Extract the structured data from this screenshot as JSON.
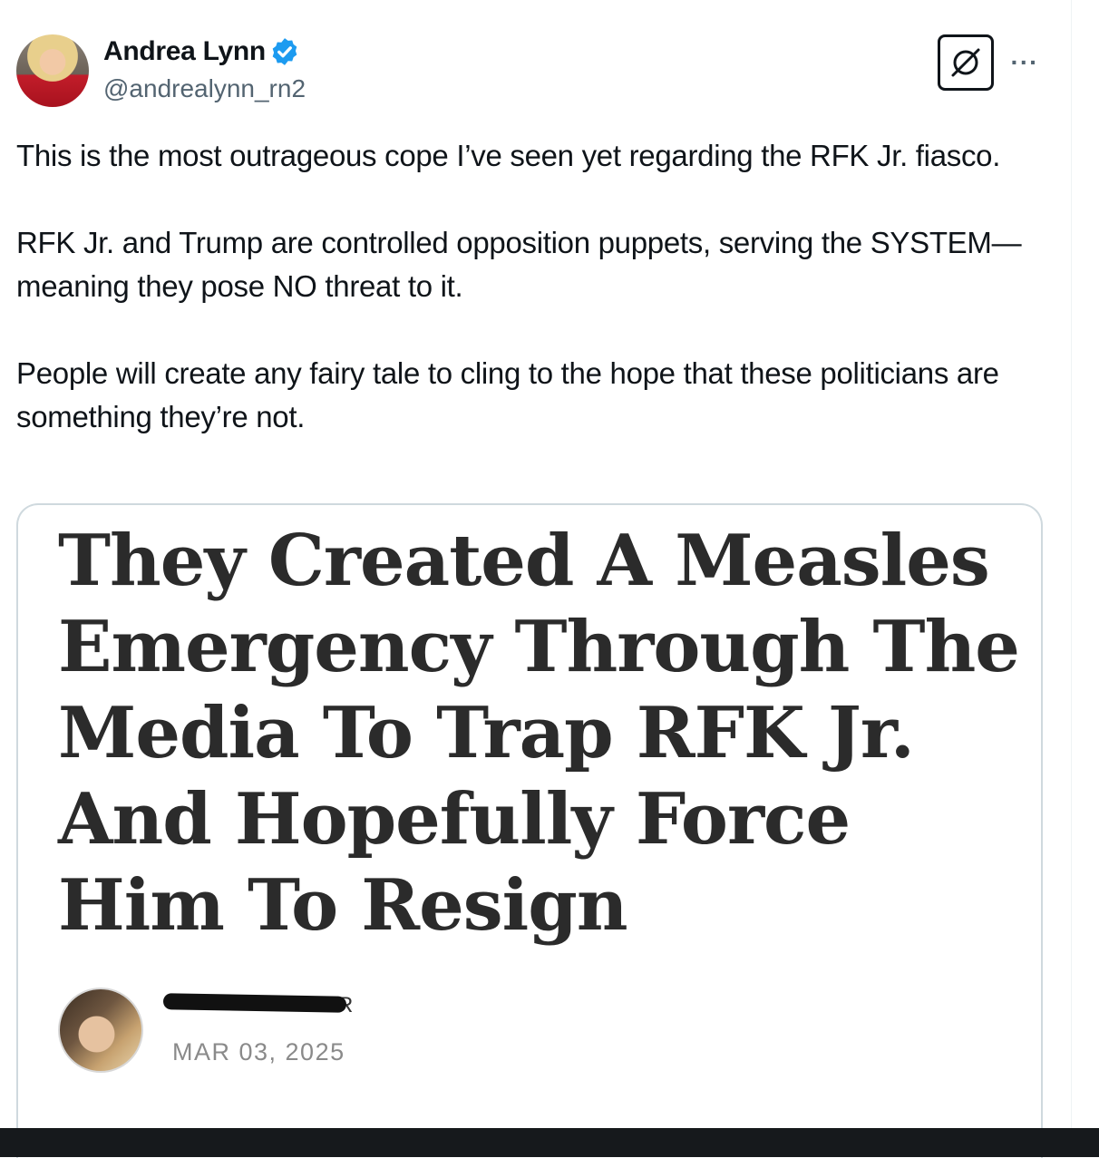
{
  "post": {
    "author": {
      "display_name": "Andrea Lynn",
      "handle": "@andrealynn_rn2",
      "verified": true,
      "badge_color": "#1d9bf0"
    },
    "paragraphs": [
      "This is the most outrageous cope I’ve seen yet regarding the RFK Jr. fiasco.",
      "RFK Jr. and Trump are controlled opposition puppets, serving the SYSTEM—meaning they pose NO threat to it.",
      "People will create any fairy tale to cling to the hope that these politicians are something they’re not."
    ],
    "more_label": "···",
    "grok_icon": "slashed-circle-icon"
  },
  "embedded_article": {
    "headline": "They Created A Measles Emergency Through The Media To Trap RFK Jr. And Hopefully Force Him To Resign",
    "author_name_visible": "R",
    "date": "MAR 03, 2025"
  }
}
